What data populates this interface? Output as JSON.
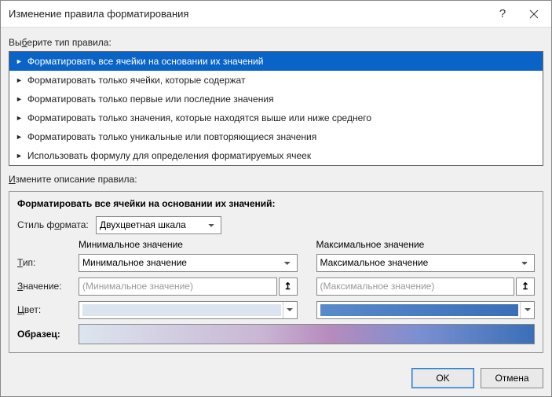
{
  "title": "Изменение правила форматирования",
  "selectRuleLabel": "Выберите тип правила:",
  "selectRuleUnderlineChar": "б",
  "ruleTypes": [
    "Форматировать все ячейки на основании их значений",
    "Форматировать только ячейки, которые содержат",
    "Форматировать только первые или последние значения",
    "Форматировать только значения, которые находятся выше или ниже среднего",
    "Форматировать только уникальные или повторяющиеся значения",
    "Использовать формулу для определения форматируемых ячеек"
  ],
  "selectedRuleIndex": 0,
  "editDescLabel": "Измените описание правила:",
  "descTitle": "Форматировать все ячейки на основании их значений:",
  "styleLabel": "Стиль формата:",
  "styleValue": "Двухцветная шкала",
  "minHeader": "Минимальное значение",
  "maxHeader": "Максимальное значение",
  "typeLabel": "Тип:",
  "valueLabel": "Значение:",
  "colorLabel": "Цвет:",
  "previewLabel": "Образец:",
  "min": {
    "type": "Минимальное значение",
    "valuePlaceholder": "(Минимальное значение)",
    "color": "#dce5ef"
  },
  "max": {
    "type": "Максимальное значение",
    "valuePlaceholder": "(Максимальное значение)",
    "color": "#3a6fb7"
  },
  "buttons": {
    "ok": "OK",
    "cancel": "Отмена"
  }
}
